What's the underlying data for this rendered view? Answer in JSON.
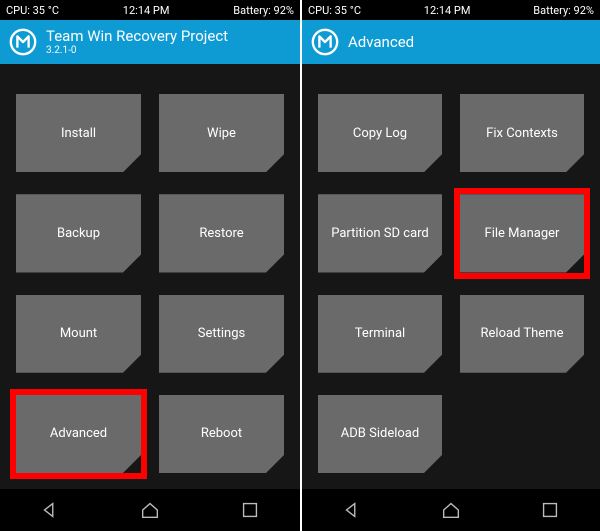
{
  "status": {
    "cpu": "CPU: 35 °C",
    "time": "12:14 PM",
    "battery": "Battery: 92%"
  },
  "colors": {
    "header_bg": "#0e9bd4",
    "tile_bg": "#6a6a6a",
    "highlight": "#ff0000",
    "bg": "#161616"
  },
  "screens": [
    {
      "title": "Team Win Recovery Project",
      "subtitle": "3.2.1-0",
      "show_subtitle": true,
      "tiles": [
        {
          "label": "Install",
          "highlight": false
        },
        {
          "label": "Wipe",
          "highlight": false
        },
        {
          "label": "Backup",
          "highlight": false
        },
        {
          "label": "Restore",
          "highlight": false
        },
        {
          "label": "Mount",
          "highlight": false
        },
        {
          "label": "Settings",
          "highlight": false
        },
        {
          "label": "Advanced",
          "highlight": true
        },
        {
          "label": "Reboot",
          "highlight": false
        }
      ]
    },
    {
      "title": "Advanced",
      "subtitle": "",
      "show_subtitle": false,
      "tiles": [
        {
          "label": "Copy Log",
          "highlight": false
        },
        {
          "label": "Fix Contexts",
          "highlight": false
        },
        {
          "label": "Partition SD card",
          "highlight": false
        },
        {
          "label": "File Manager",
          "highlight": true
        },
        {
          "label": "Terminal",
          "highlight": false
        },
        {
          "label": "Reload Theme",
          "highlight": false
        },
        {
          "label": "ADB Sideload",
          "highlight": false
        },
        {
          "label": "",
          "highlight": false,
          "empty": true
        }
      ]
    }
  ]
}
